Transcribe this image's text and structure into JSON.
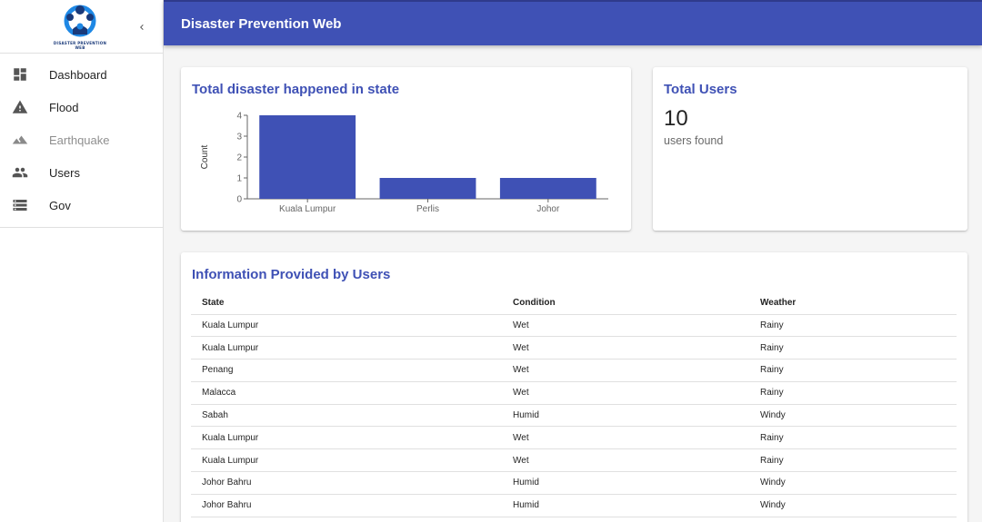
{
  "app": {
    "title": "Disaster Prevention Web",
    "logo_text": "DISASTER PREVENTION WEB"
  },
  "sidebar": {
    "items": [
      {
        "label": "Dashboard",
        "icon": "dashboard-icon",
        "disabled": false
      },
      {
        "label": "Flood",
        "icon": "warning-icon",
        "disabled": false
      },
      {
        "label": "Earthquake",
        "icon": "terrain-icon",
        "disabled": true
      },
      {
        "label": "Users",
        "icon": "people-icon",
        "disabled": false
      },
      {
        "label": "Gov",
        "icon": "storage-icon",
        "disabled": false
      }
    ]
  },
  "chart_card": {
    "title": "Total disaster happened in state"
  },
  "chart_data": {
    "type": "bar",
    "categories": [
      "Kuala Lumpur",
      "Perlis",
      "Johor"
    ],
    "values": [
      4,
      1,
      1
    ],
    "ylabel": "Count",
    "xlabel": "",
    "ylim": [
      0,
      4
    ],
    "yticks": [
      0,
      1,
      2,
      3,
      4
    ],
    "bar_color": "#3f51b5"
  },
  "users_card": {
    "title": "Total Users",
    "count": "10",
    "subtitle": "users found"
  },
  "table": {
    "title": "Information Provided by Users",
    "headers": {
      "state": "State",
      "condition": "Condition",
      "weather": "Weather"
    },
    "rows": [
      {
        "state": "Kuala Lumpur",
        "condition": "Wet",
        "weather": "Rainy"
      },
      {
        "state": "Kuala Lumpur",
        "condition": "Wet",
        "weather": "Rainy"
      },
      {
        "state": "Penang",
        "condition": "Wet",
        "weather": "Rainy"
      },
      {
        "state": "Malacca",
        "condition": "Wet",
        "weather": "Rainy"
      },
      {
        "state": "Sabah",
        "condition": "Humid",
        "weather": "Windy"
      },
      {
        "state": "Kuala Lumpur",
        "condition": "Wet",
        "weather": "Rainy"
      },
      {
        "state": "Kuala Lumpur",
        "condition": "Wet",
        "weather": "Rainy"
      },
      {
        "state": "Johor Bahru",
        "condition": "Humid",
        "weather": "Windy"
      },
      {
        "state": "Johor Bahru",
        "condition": "Humid",
        "weather": "Windy"
      }
    ]
  },
  "colors": {
    "primary": "#3f51b5",
    "primary_dark": "#2f3a8c"
  }
}
